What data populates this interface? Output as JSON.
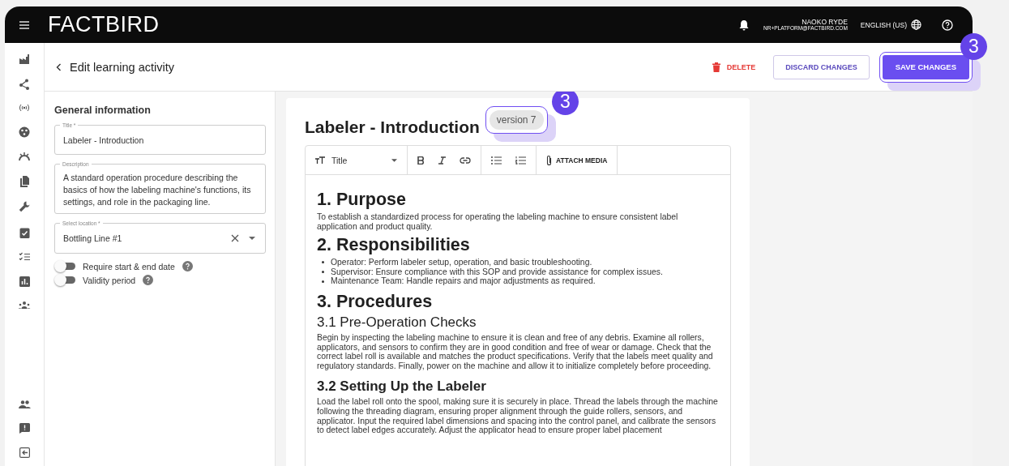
{
  "topbar": {
    "logo": "FACTBIRD",
    "user_name": "NAOKO RYDE",
    "user_email": "NR+PLATFORM@FACTBIRD.COM",
    "language": "ENGLISH (US)"
  },
  "header": {
    "title": "Edit learning activity",
    "delete": "DELETE",
    "discard": "DISCARD CHANGES",
    "save": "SAVE CHANGES",
    "save_callout": "3"
  },
  "form": {
    "heading": "General information",
    "fields": [
      {
        "kind": "text",
        "label": "Title *",
        "value": "Labeler - Introduction"
      },
      {
        "kind": "textarea",
        "label": "Description",
        "value": "A standard operation procedure describing the basics of how the labeling machine's functions, its settings, and role in the packaging line."
      },
      {
        "kind": "select",
        "label": "Select location *",
        "value": "Bottling Line #1"
      }
    ],
    "toggles": [
      {
        "label": "Require start & end date",
        "on": false
      },
      {
        "label": "Validity period",
        "on": false
      }
    ]
  },
  "document": {
    "title": "Labeler - Introduction",
    "version": "version 7",
    "version_callout": "3",
    "toolbar": {
      "style": "Title",
      "attach": "ATTACH MEDIA"
    },
    "blocks": [
      {
        "kind": "h1",
        "text": "1. Purpose"
      },
      {
        "kind": "p",
        "text": "To establish a standardized process for operating the labeling machine to ensure consistent label application and product quality."
      },
      {
        "kind": "h1",
        "text": "2. Responsibilities"
      },
      {
        "kind": "ul",
        "items": [
          "Operator: Perform labeler setup, operation, and basic troubleshooting.",
          "Supervisor: Ensure compliance with this SOP and provide assistance for complex issues.",
          "Maintenance Team: Handle repairs and major adjustments as required."
        ]
      },
      {
        "kind": "h1",
        "text": "3. Procedures"
      },
      {
        "kind": "h2",
        "text": "3.1 Pre-Operation Checks"
      },
      {
        "kind": "p",
        "text": "Begin by inspecting the labeling machine to ensure it is clean and free of any debris. Examine all rollers, applicators, and sensors to confirm they are in good condition and free of wear or damage. Check that the correct label roll is available and matches the product specifications. Verify that the labels meet quality and regulatory standards. Finally, power on the machine and allow it to initialize completely before proceeding."
      },
      {
        "kind": "h3",
        "text": "3.2 Setting Up the Labeler"
      },
      {
        "kind": "p",
        "text": "Load the label roll onto the spool, making sure it is securely in place. Thread the labels through the machine following the threading diagram, ensuring proper alignment through the guide rollers, sensors, and applicator. Input the required label dimensions and spacing into the control panel, and calibrate the sensors to detect label edges accurately. Adjust the applicator head to ensure proper label placement"
      }
    ]
  }
}
